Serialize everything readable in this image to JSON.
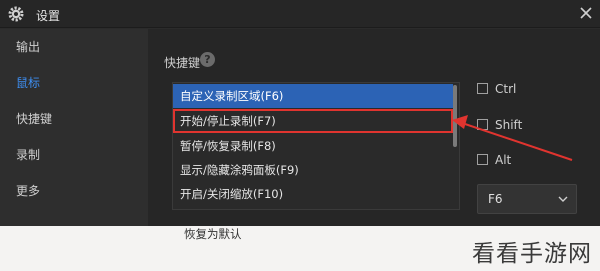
{
  "window": {
    "title": "设置",
    "accent": "#3e8ef0"
  },
  "sidebar": {
    "items": [
      {
        "label": "输出",
        "active": false
      },
      {
        "label": "鼠标",
        "active": true
      },
      {
        "label": "快捷键",
        "active": false
      },
      {
        "label": "录制",
        "active": false
      },
      {
        "label": "更多",
        "active": false
      }
    ]
  },
  "shortcuts": {
    "section_label": "快捷键",
    "help_glyph": "?",
    "actions": [
      {
        "label": "自定义录制区域(F6)",
        "selected": true,
        "highlighted": false
      },
      {
        "label": "开始/停止录制(F7)",
        "selected": false,
        "highlighted": true
      },
      {
        "label": "暂停/恢复录制(F8)",
        "selected": false,
        "highlighted": false
      },
      {
        "label": "显示/隐藏涂鸦面板(F9)",
        "selected": false,
        "highlighted": false
      },
      {
        "label": "开启/关闭缩放(F10)",
        "selected": false,
        "highlighted": false
      }
    ],
    "modifiers": {
      "ctrl": {
        "label": "Ctrl",
        "checked": false
      },
      "shift": {
        "label": "Shift",
        "checked": false
      },
      "alt": {
        "label": "Alt",
        "checked": false
      }
    },
    "key_select": {
      "value": "F6"
    },
    "restore_label": "恢复为默认",
    "highlight_color": "#e0342f",
    "selection_color": "#2c63b5"
  },
  "watermark": {
    "text": "看看手游网"
  },
  "icons": {
    "title": "gear-icon",
    "close": "close-icon",
    "help": "question-mark-icon",
    "select": "chevron-down-icon"
  }
}
